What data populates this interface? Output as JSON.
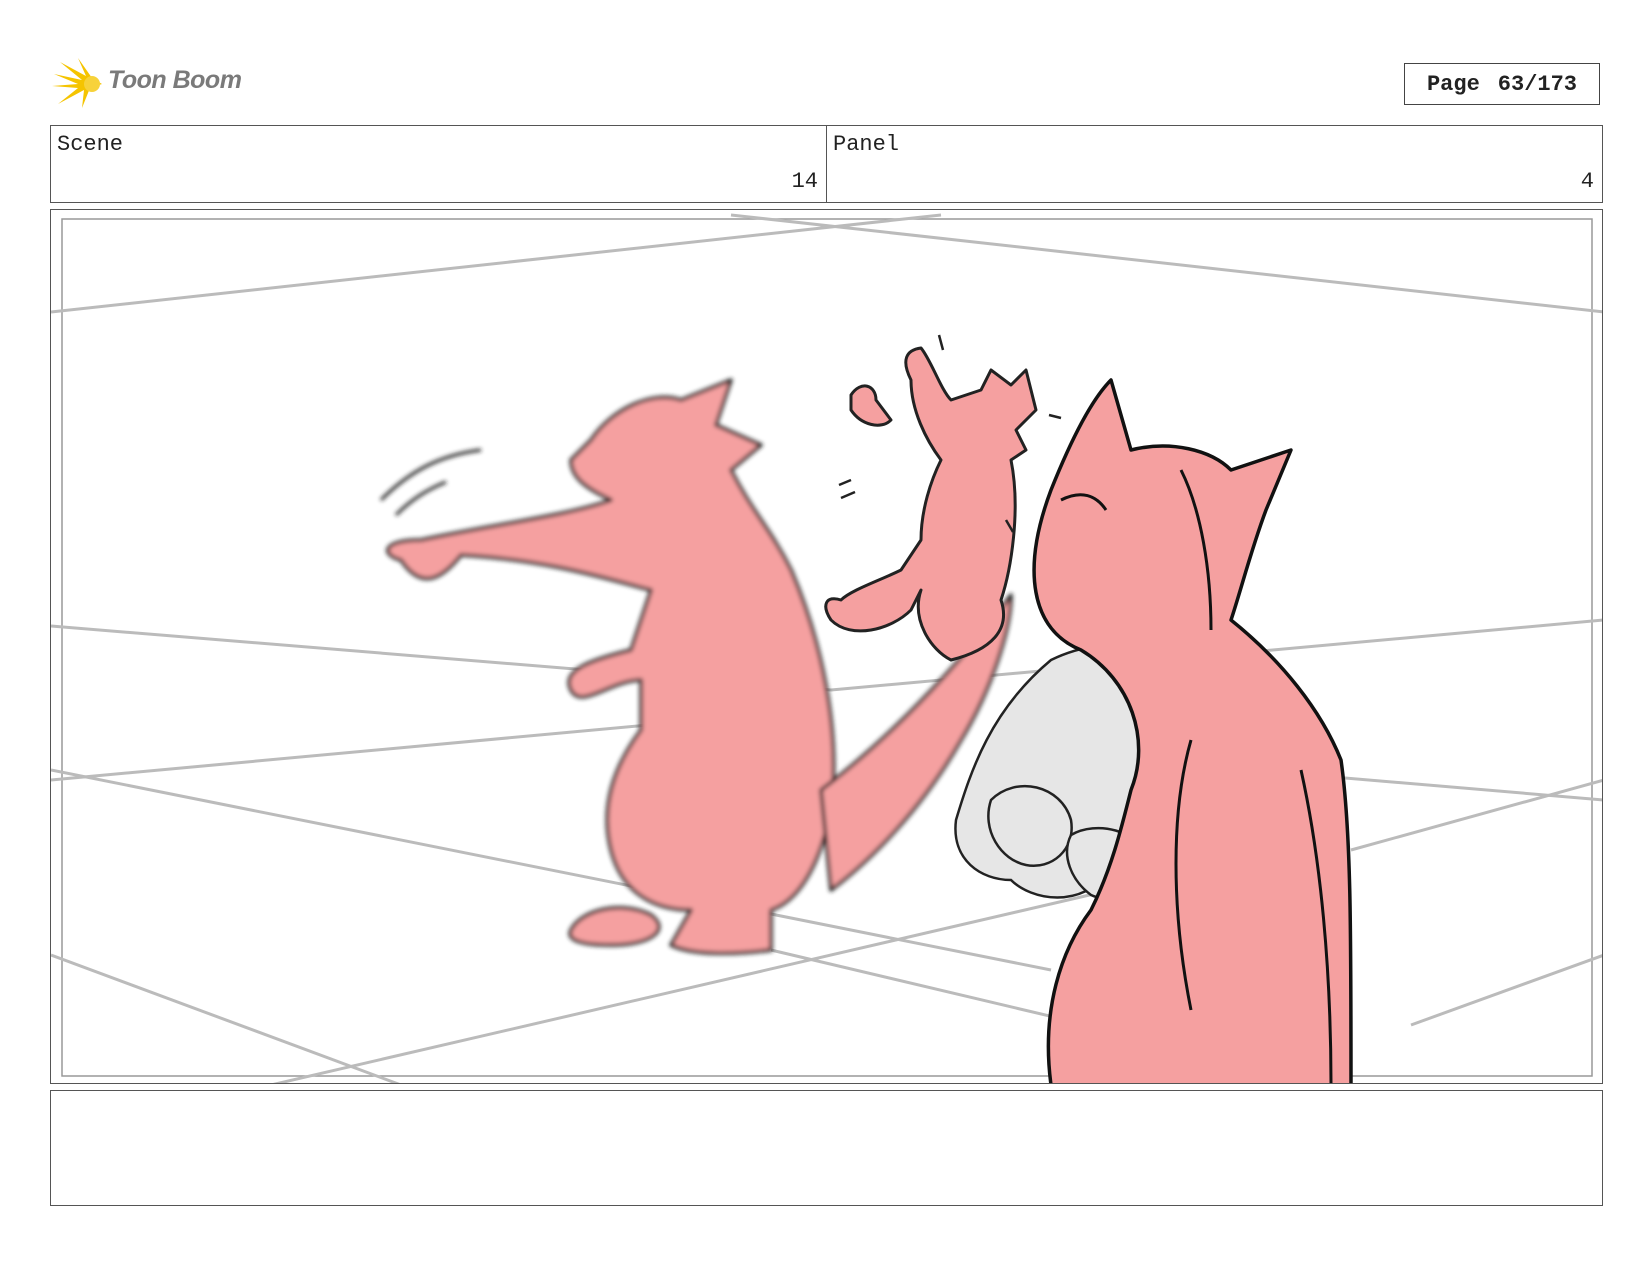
{
  "header": {
    "logo_text": "Toon Boom",
    "page_label": "Page",
    "page_number": "63/173"
  },
  "info": {
    "scene_label": "Scene",
    "scene_value": "14",
    "panel_label": "Panel",
    "panel_value": "4"
  },
  "notes": {
    "text": ""
  },
  "colors": {
    "character_fill": "#f5a0a0",
    "rock_fill": "#e6e6e6",
    "guide_lines": "#bbbbbb",
    "logo_accent": "#f5c400"
  },
  "icons": {
    "logo": "starburst-icon"
  }
}
